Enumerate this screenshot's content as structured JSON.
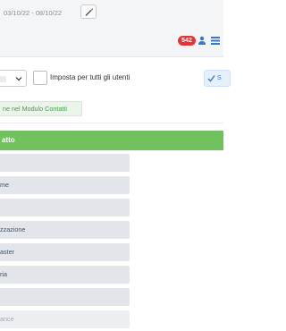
{
  "header": {
    "date_range": "03/10/22 - 08/10/22",
    "notification_count": "542"
  },
  "controls": {
    "checkbox_label": "Imposta per tutti gli utenti",
    "save_label": "S"
  },
  "contact_module_link": "ne nel Modulo Contatti",
  "section_title": "atto",
  "fields": [
    "",
    "me",
    "",
    "zzazione",
    "aster",
    "ria",
    "",
    "ance"
  ],
  "colors": {
    "accent_green": "#72c15f",
    "badge_red": "#e0363a",
    "link_blue": "#3a78c9"
  }
}
